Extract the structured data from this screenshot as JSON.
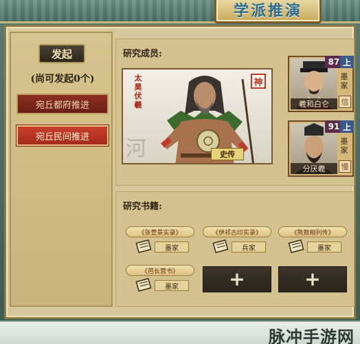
{
  "header": {
    "title": "学派推演"
  },
  "sidebar": {
    "start_label": "发起",
    "remaining_text": "(尚可发起0个)",
    "options": [
      {
        "label": "宛丘都府推进",
        "active": false
      },
      {
        "label": "宛丘民间推进",
        "active": true
      }
    ]
  },
  "members": {
    "label": "研究成员:",
    "leader": {
      "sect": "太昊伏羲",
      "rank": "神",
      "name": "史传",
      "background_char": "河"
    },
    "list": [
      {
        "level": "87",
        "up": "上",
        "school": "墨家",
        "trait": "信",
        "name": "羲和白仑"
      },
      {
        "level": "91",
        "up": "上",
        "school": "墨家",
        "trait": "慢",
        "name": "分厌羲"
      }
    ]
  },
  "books": {
    "label": "研究书籍:",
    "items": [
      {
        "title": "《张萱景实录》",
        "school": "墨家"
      },
      {
        "title": "《伊祁古印实录》",
        "school": "兵家"
      },
      {
        "title": "《熊敖相列传》",
        "school": "墨家"
      },
      {
        "title": "《芭长营书》",
        "school": "墨家"
      }
    ],
    "empty_slot_symbol": "+"
  },
  "watermark": "脉冲手游网"
}
